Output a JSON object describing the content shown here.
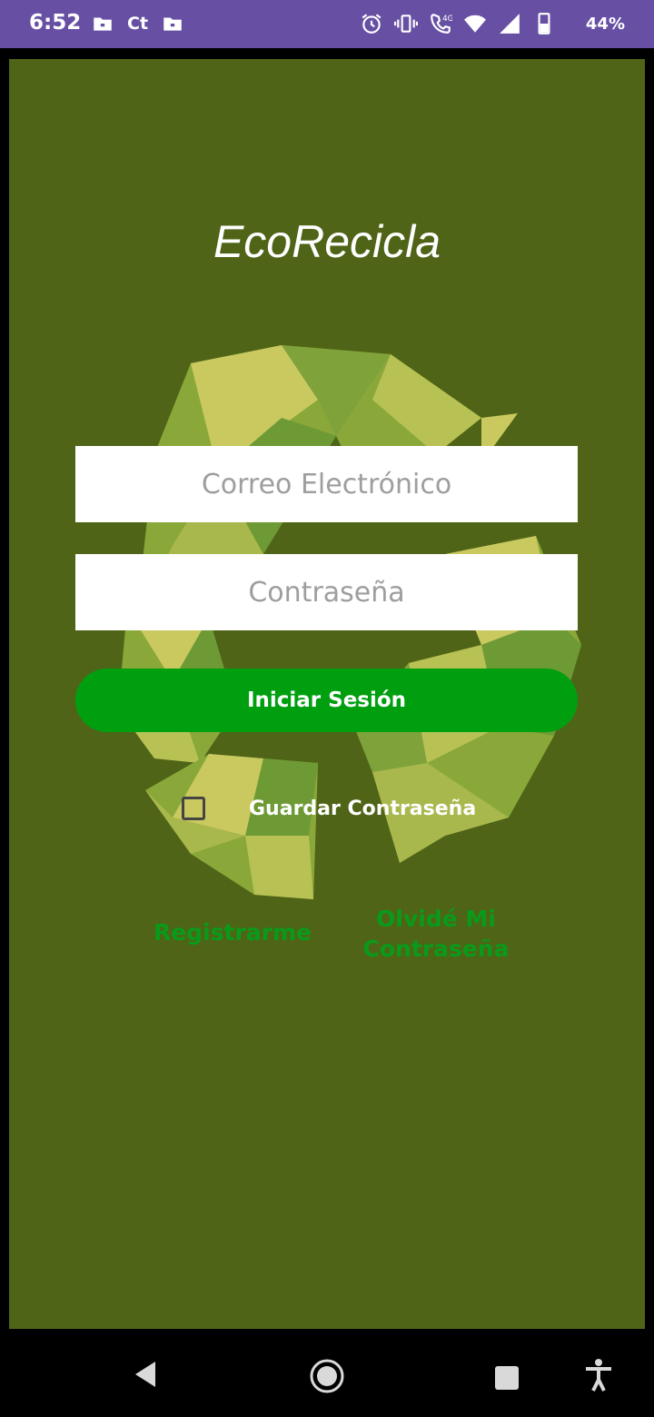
{
  "status_bar": {
    "time": "6:52",
    "carrier_glyph": "Ct",
    "battery": "44%",
    "background": "#6750a4",
    "icons": [
      "folder-icon",
      "ct-icon",
      "folder-icon",
      "alarm-icon",
      "vibrate-icon",
      "call-4g-icon",
      "wifi-icon",
      "signal-icon",
      "battery-icon"
    ]
  },
  "app": {
    "title": "EcoRecicla",
    "background": "#4f6417",
    "email_placeholder": "Correo Electrónico",
    "password_placeholder": "Contraseña",
    "login_label": "Iniciar Sesión",
    "login_color": "#009f10",
    "remember_label": "Guardar Contraseña",
    "remember_checked": false,
    "register_link": "Registrarme",
    "forgot_link_line1": "Olvidé Mi",
    "forgot_link_line2": "Contraseña",
    "link_color": "#0a9a1a"
  },
  "nav_bar": {
    "icons": [
      "back-icon",
      "home-icon",
      "recents-icon",
      "accessibility-icon"
    ]
  }
}
